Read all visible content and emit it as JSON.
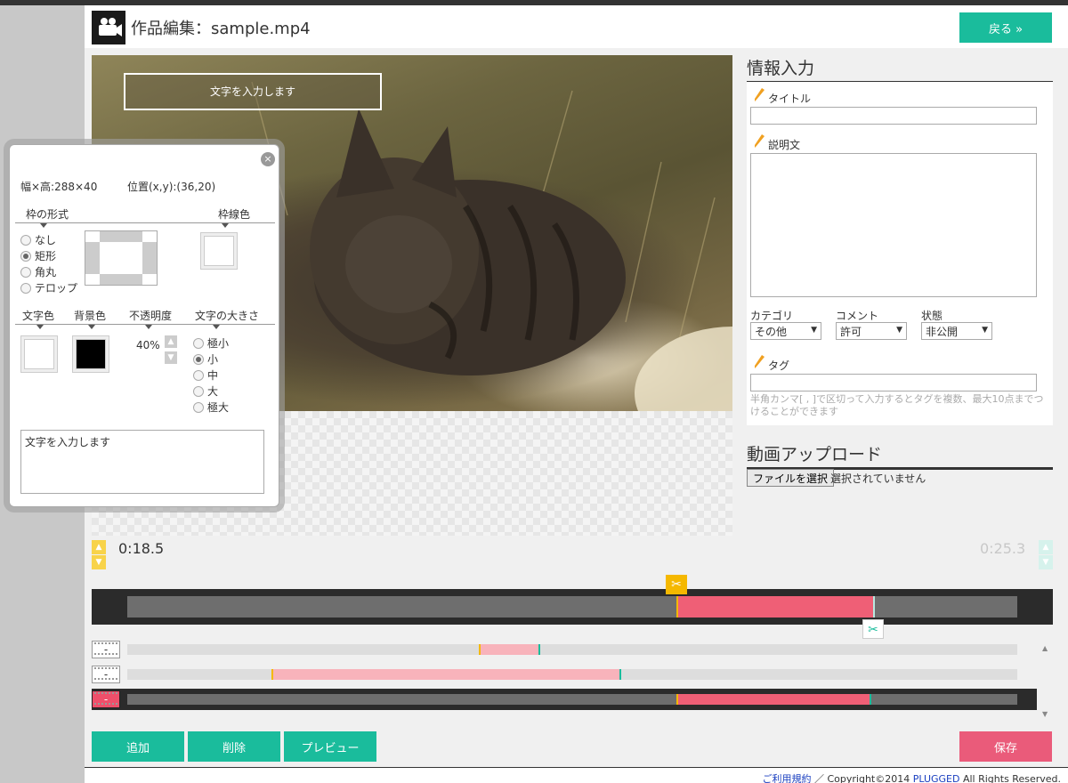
{
  "header": {
    "title": "作品編集：sample.mp4",
    "back_label": "戻る »"
  },
  "preview": {
    "overlay_text": "文字を入力します"
  },
  "text_panel": {
    "size_label": "幅×高:288×40",
    "position_label": "位置(x,y):(36,20)",
    "frame_style_label": "枠の形式",
    "border_color_label": "枠線色",
    "frame_options": [
      "なし",
      "矩形",
      "角丸",
      "テロップ"
    ],
    "frame_selected": "矩形",
    "text_color_label": "文字色",
    "bg_color_label": "背景色",
    "opacity_label": "不透明度",
    "opacity_value": "40%",
    "text_size_label": "文字の大きさ",
    "size_options": [
      "極小",
      "小",
      "中",
      "大",
      "極大"
    ],
    "size_selected": "小",
    "text_value": "文字を入力します",
    "colors": {
      "border": "#ffffff",
      "text": "#ffffff",
      "background": "#000000"
    }
  },
  "info": {
    "heading": "情報入力",
    "title_label": "タイトル",
    "title_value": "",
    "description_label": "説明文",
    "description_value": "",
    "category_label": "カテゴリ",
    "category_value": "その他",
    "comment_label": "コメント",
    "comment_value": "許可",
    "status_label": "状態",
    "status_value": "非公開",
    "tag_label": "タグ",
    "tag_value": "",
    "tag_hint": "半角カンマ[ , ]で区切って入力するとタグを複数、最大10点までつけることができます"
  },
  "upload": {
    "heading": "動画アップロード",
    "file_button": "ファイルを選択",
    "file_status": "選択されていません"
  },
  "timeline": {
    "current_time": "0:18.5",
    "end_time": "0:25.3",
    "duration_sec": 25.3,
    "selection_start_sec": 15.6,
    "selection_end_sec": 21.2,
    "clips": [
      {
        "toggle": "-",
        "start_sec": 10.0,
        "end_sec": 11.7,
        "active": false
      },
      {
        "toggle": "-",
        "start_sec": 4.1,
        "end_sec": 14.0,
        "active": false
      },
      {
        "toggle": "-",
        "start_sec": 15.6,
        "end_sec": 21.1,
        "active": true
      }
    ]
  },
  "buttons": {
    "add": "追加",
    "delete": "削除",
    "preview": "プレビュー",
    "save": "保存"
  },
  "footer": {
    "terms_link": "ご利用規約",
    "separator": "／",
    "copyright_pre": "Copyright©2014",
    "company_link": "PLUGGED",
    "rights": "All Rights Reserved."
  },
  "icons": {
    "logo": "video-camera-icon",
    "field": "pencil-icon",
    "cut": "scissors-icon",
    "close": "close-icon"
  },
  "accent_colors": {
    "green": "#1abc9c",
    "red": "#ea5b7a",
    "yellow": "#f5b800"
  }
}
